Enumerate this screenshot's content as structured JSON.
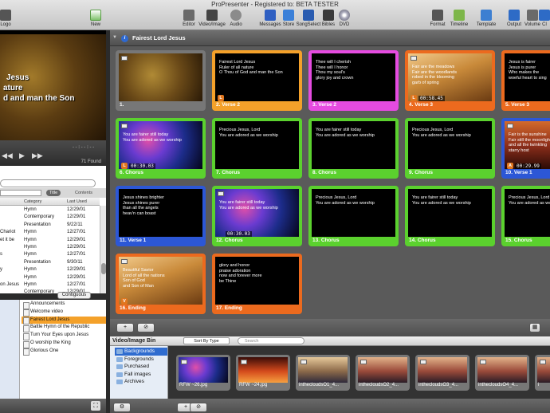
{
  "window": {
    "title": "ProPresenter - Registered to: BETA TESTER"
  },
  "toolbar": {
    "left": [
      {
        "id": "logo",
        "label": "Logo"
      },
      {
        "id": "new",
        "label": "New"
      }
    ],
    "center": [
      {
        "id": "editor",
        "label": "Editor"
      },
      {
        "id": "video-image",
        "label": "Video/Image"
      },
      {
        "id": "audio",
        "label": "Audio"
      },
      {
        "id": "messages",
        "label": "Messages"
      },
      {
        "id": "store",
        "label": "Store"
      },
      {
        "id": "songselect",
        "label": "SongSelect"
      },
      {
        "id": "bibles",
        "label": "Bibles"
      },
      {
        "id": "dvd",
        "label": "DVD"
      }
    ],
    "right": [
      {
        "id": "format",
        "label": "Format"
      },
      {
        "id": "timeline",
        "label": "Timeline"
      },
      {
        "id": "template",
        "label": "Template"
      },
      {
        "id": "output",
        "label": "Output"
      },
      {
        "id": "volume",
        "label": "Volume"
      },
      {
        "id": "clear",
        "label": "Cl"
      }
    ]
  },
  "preview": {
    "lines": [
      "Jesus",
      "ature",
      "d and man the Son"
    ],
    "transport": {
      "time": "--:--:--",
      "found": "71 Found",
      "play_glyph": "▶",
      "prev_glyph": "◀◀",
      "next_glyph": "▶▶"
    }
  },
  "library": {
    "tabs": {
      "title": "Title",
      "contents": "Contents"
    },
    "headers": {
      "category": "Category",
      "last_used": "Last Used"
    },
    "rows": [
      {
        "title": "",
        "category": "Hymn",
        "last_used": "12/29/01"
      },
      {
        "title": "",
        "category": "Contemporary",
        "last_used": "12/29/01"
      },
      {
        "title": "",
        "category": "Presentation",
        "last_used": "9/22/11"
      },
      {
        "title": "Chariot",
        "category": "Hymn",
        "last_used": "12/27/01"
      },
      {
        "title": "et it be",
        "category": "Hymn",
        "last_used": "12/29/01"
      },
      {
        "title": "",
        "category": "Hymn",
        "last_used": "12/29/01"
      },
      {
        "title": "s",
        "category": "Hymn",
        "last_used": "12/27/01"
      },
      {
        "title": "",
        "category": "Presentation",
        "last_used": "9/30/11"
      },
      {
        "title": "y",
        "category": "Hymn",
        "last_used": "12/29/01"
      },
      {
        "title": "",
        "category": "Hymn",
        "last_used": "12/29/01"
      },
      {
        "title": "on Jesus",
        "category": "Hymn",
        "last_used": "12/27/01"
      },
      {
        "title": "",
        "category": "Contemporary",
        "last_used": "12/29/01"
      },
      {
        "title": "",
        "category": "Presentation",
        "last_used": "9/26/11"
      }
    ],
    "contiguous_label": "Contiguous"
  },
  "playlist": {
    "items": [
      "Announcements",
      "Welcome video",
      "Fairest Lord Jesus",
      "Battle Hymn of the Republic",
      "Turn Your Eyes upon Jesus",
      "O worship the King",
      "Glorious One"
    ],
    "selected": 2,
    "add_glyph": "+",
    "none_glyph": "⊘"
  },
  "presentation": {
    "title": "Fairest Lord Jesus",
    "info_glyph": "i",
    "slides": [
      {
        "label": "1.",
        "text": "",
        "color": "#777777",
        "bg": "gold-cross",
        "time": "",
        "badge": ""
      },
      {
        "label": "2. Verse 2",
        "text": "Fairest Lord Jesus\nRuler of all nature\nO Thou of God and man the Son",
        "color": "#f4a12a",
        "bg": "black",
        "time": "",
        "badge": "L"
      },
      {
        "label": "3. Verse 2",
        "text": "Thee will I cherish\nThee will I honor\nThou my soul's\nglory joy and crown",
        "color": "#e54be0",
        "bg": "black",
        "time": "",
        "badge": ""
      },
      {
        "label": "4. Verse 3",
        "text": "Fair are the meadows\nFair are the woodlands\nrobed in the blooming\ngarb of spring",
        "color": "#ec6a1e",
        "bg": "wheat",
        "time": "00:58.45",
        "badge": "L"
      },
      {
        "label": "5. Verse 3",
        "text": "Jesus is fairer\nJesus is purer\nWho makes the\nwoeful heart to sing",
        "color": "#ec6a1e",
        "bg": "black",
        "time": "",
        "badge": ""
      },
      {
        "label": "6. Chorus",
        "text": "You are fairer still today\nYou are adored as we worship",
        "color": "#5bd12e",
        "bg": "nebula",
        "time": "00:30.03",
        "badge": "L"
      },
      {
        "label": "7. Chorus",
        "text": "Precious Jesus, Lord\nYou are adored as we worship",
        "color": "#5bd12e",
        "bg": "black",
        "time": "",
        "badge": ""
      },
      {
        "label": "8. Chorus",
        "text": "You are fairer still today\nYou are adored as we worship",
        "color": "#5bd12e",
        "bg": "black",
        "time": "",
        "badge": ""
      },
      {
        "label": "9. Chorus",
        "text": "Precious Jesus, Lord\nYou are adored as we worship",
        "color": "#5bd12e",
        "bg": "black",
        "time": "",
        "badge": ""
      },
      {
        "label": "10. Verse 1",
        "text": "Fair is the sunshine\nFair still the moonlight\nand all the twinkling\nstarry host",
        "color": "#2c57d6",
        "bg": "sunset",
        "time": "00:29.99",
        "badge": "A"
      },
      {
        "label": "11. Verse 1",
        "text": "Jesus shines brighter\nJesus shines purer\nthan all the angels\nheav'n can boast",
        "color": "#2c57d6",
        "bg": "black",
        "time": "",
        "badge": ""
      },
      {
        "label": "12. Chorus",
        "text": "You are fairer still today\nYou are adored as we worship",
        "color": "#5bd12e",
        "bg": "nebula",
        "time": "00:30.03",
        "badge": ""
      },
      {
        "label": "13. Chorus",
        "text": "Precious Jesus, Lord\nYou are adored as we worship",
        "color": "#5bd12e",
        "bg": "black",
        "time": "",
        "badge": ""
      },
      {
        "label": "14. Chorus",
        "text": "You are fairer still today\nYou are adored as we worship",
        "color": "#5bd12e",
        "bg": "black",
        "time": "",
        "badge": ""
      },
      {
        "label": "15. Chorus",
        "text": "Precious Jesus, Lord\nYou are adored as we worship",
        "color": "#5bd12e",
        "bg": "black",
        "time": "",
        "badge": ""
      },
      {
        "label": "16. Ending",
        "text": "Beautiful Savior\nLord of all the nations\nSon of God\nand Son of Man",
        "color": "#ec6a1e",
        "bg": "wheat",
        "time": "",
        "badge": "V"
      },
      {
        "label": "17. Ending",
        "text": "glory and honor\npraise adoration\nnow and forever more\nbe Thine",
        "color": "#ec6a1e",
        "bg": "black",
        "time": "",
        "badge": ""
      }
    ],
    "bottom": {
      "add_glyph": "+",
      "none_glyph": "⊘"
    }
  },
  "media_bin": {
    "title": "Video/Image Bin",
    "sort_label": "Sort By Type",
    "search_placeholder": "Search",
    "folders": [
      "Backgrounds",
      "Foregrounds",
      "Purchased",
      "Fall images",
      "Archives"
    ],
    "selected_folder": 0,
    "thumbs": [
      {
        "label": "RFW ~26.jpg",
        "bg": "nebula"
      },
      {
        "label": "RFW ~24.jpg",
        "bg": "fire"
      },
      {
        "label": "inthecloudsO1_4...",
        "bg": "clouds"
      },
      {
        "label": "inthecloudsO2_4...",
        "bg": "clouds2"
      },
      {
        "label": "inthecloudsO3_4...",
        "bg": "clouds2"
      },
      {
        "label": "inthecloudsO4_4...",
        "bg": "clouds2"
      },
      {
        "label": "i",
        "bg": "clouds2"
      }
    ],
    "bottom": {
      "gear_glyph": "⚙",
      "add_glyph": "+",
      "none_glyph": "⊘"
    }
  },
  "colors": {
    "accent_orange": "#f4a12a",
    "chorus_green": "#5bd12e",
    "verse_blue": "#2c57d6",
    "selection_blue": "#2f6ccf"
  }
}
